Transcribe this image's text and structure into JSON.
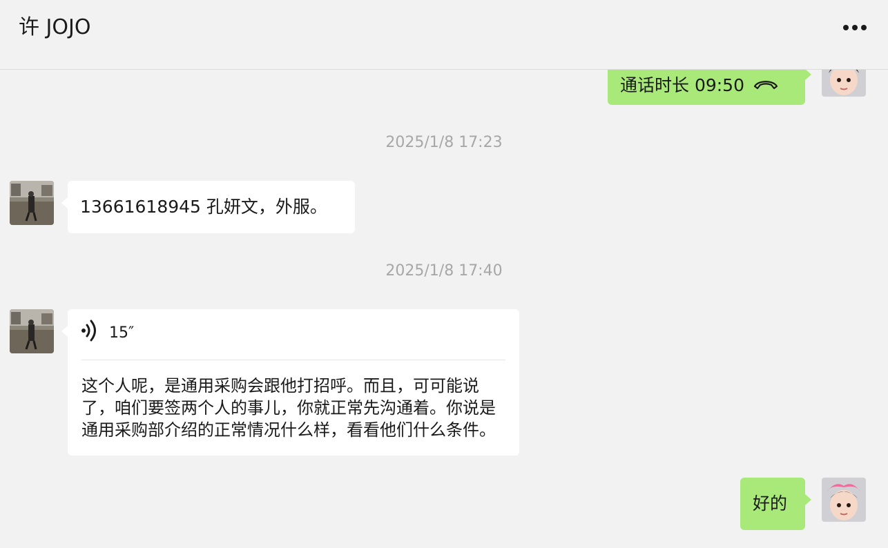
{
  "header": {
    "title": "许 JOJO",
    "more_icon": "more-horizontal-icon"
  },
  "messages": {
    "call": {
      "text": "通话时长 09:50",
      "icon": "phone-hangup-icon",
      "side": "right"
    },
    "timestamp_1": "2025/1/8 17:23",
    "contact_text": "13661618945 孔妍文，外服。",
    "timestamp_2": "2025/1/8 17:40",
    "voice": {
      "duration": "15″",
      "icon": "voice-wave-icon",
      "transcript": "这个人呢，是通用采购会跟他打招呼。而且，可可能说了，咱们要签两个人的事儿，你就正常先沟通着。你说是通用采购部介绍的正常情况什么样，看看他们什么条件。"
    },
    "reply": "好的"
  },
  "colors": {
    "background": "#f2f2f2",
    "sent_bubble": "#a9e97a",
    "received_bubble": "#ffffff",
    "timestamp": "#a7a7a7"
  }
}
